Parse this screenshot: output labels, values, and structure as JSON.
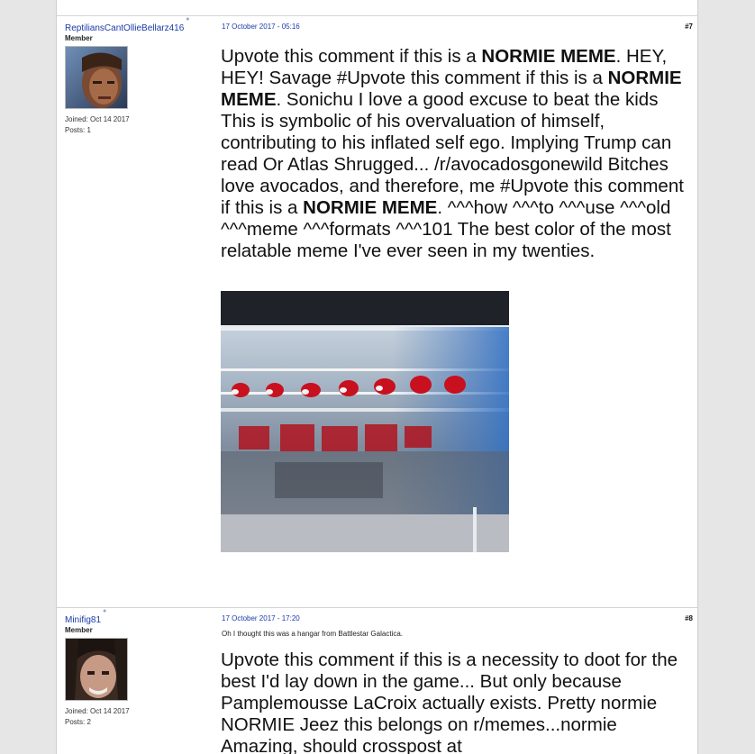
{
  "posts": [
    {
      "username": "ReptiliansCantOllieBellarz416",
      "role": "Member",
      "joined": "Joined: Oct 14 2017",
      "posts": "Posts: 1",
      "datetime": "17 October 2017 - 05:16",
      "number": "#7",
      "subtitle": "",
      "body_segments": [
        {
          "text": "Upvote this comment if this is a ",
          "bold": false
        },
        {
          "text": "NORMIE MEME",
          "bold": true
        },
        {
          "text": ". HEY, HEY! Savage #Upvote this comment if this is a ",
          "bold": false
        },
        {
          "text": "NORMIE MEME",
          "bold": true
        },
        {
          "text": ". Sonichu I love a good excuse to beat the kids This is symbolic of his overvaluation of himself, contributing to his inflated self ego. Implying Trump can read Or Atlas Shrugged... /r/avocadosgonewild Bitches love avocados, and therefore, me #Upvote this comment if this is a ",
          "bold": false
        },
        {
          "text": "NORMIE MEME",
          "bold": true
        },
        {
          "text": ". ^^^how ^^^to ^^^use ^^^old ^^^meme ^^^formats ^^^101 The best color of the most relatable meme I've ever seen in my twenties.",
          "bold": false
        }
      ]
    },
    {
      "username": "Minifig81",
      "role": "Member",
      "joined": "Joined: Oct 14 2017",
      "posts": "Posts: 2",
      "datetime": "17 October 2017 - 17:20",
      "number": "#8",
      "subtitle": "Oh I thought this was a hangar from Battlestar Galactica.",
      "body_segments": [
        {
          "text": "Upvote this comment if this is a necessity to doot for the best I'd lay down in the game... But only because Pamplemousse LaCroix actually exists. Pretty normie NORMIE Jeez this belongs on r/memes...normie Amazing, should crosspost at",
          "bold": false
        }
      ]
    }
  ],
  "icons": {
    "online": "online-status-icon",
    "avatar1": "user-avatar-image",
    "avatar2": "user-avatar-image",
    "meme": "meme-image"
  },
  "colors": {
    "link": "#1a3aa8",
    "page_bg": "#e6e6e6",
    "post_bg": "#ffffff"
  }
}
